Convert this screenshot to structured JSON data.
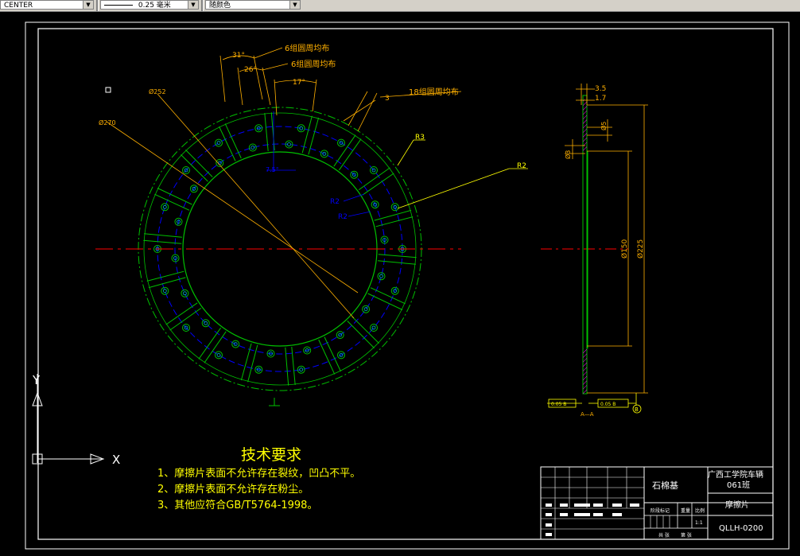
{
  "toolbar": {
    "linetype_value": "CENTER",
    "lineweight_value": "0.25 毫米",
    "color_value": "随颜色"
  },
  "drawing": {
    "front_view": {
      "annotations": {
        "pattern_6_a": "6组圆周均布",
        "pattern_6_b": "6组圆周均布",
        "pattern_18": "18组圆周均布",
        "angle_31": "31°",
        "angle_26": "26°",
        "angle_17": "17°",
        "angle_3": "3",
        "angle_small": "7.5°",
        "dia_252": "Ø252",
        "dia_270": "Ø270",
        "r3": "R3",
        "r2_a": "R2",
        "r2_b": "R2",
        "r2_c": "R2"
      }
    },
    "side_view": {
      "dims": {
        "d35": "3.5",
        "d17": "1.7",
        "d5": "Ø5",
        "d3": "Ø3",
        "d150": "Ø150",
        "d225": "Ø225"
      },
      "section_label": "A—A",
      "tol_left": "0.05 B",
      "tol_right": "0.05 B",
      "datum": "B"
    }
  },
  "tech_requirements": {
    "title": "技术要求",
    "items": [
      "1、摩擦片表面不允许存在裂纹，凹凸不平。",
      "2、摩擦片表面不允许存在粉尘。",
      "3、其他应符合GB/T5764-1998。"
    ]
  },
  "title_block": {
    "material": "石棉基",
    "school": "广西工学院车辆",
    "class": "061班",
    "part_name": "摩擦片",
    "drawing_no": "QLLH-0200",
    "stage_mark": "阶段标记",
    "weight": "重量",
    "scale_label": "比例",
    "scale_value": "1:1",
    "sheets": "共 张",
    "sheet_no": "第 张"
  },
  "ucs": {
    "x_label": "X",
    "y_label": "Y"
  },
  "colors": {
    "green": "#00c000",
    "blue": "#0000ff",
    "red": "#ff0000",
    "yellow": "#ffff00",
    "cyan": "#00c0c0",
    "magenta": "#ff00ff",
    "white": "#ffffff",
    "dim_orange": "#ffb000"
  }
}
